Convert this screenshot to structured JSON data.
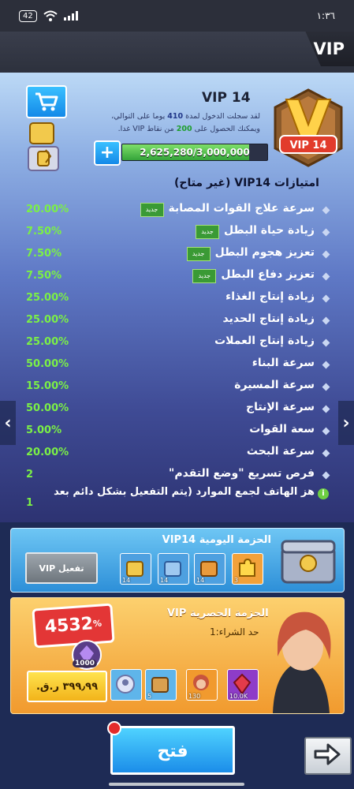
{
  "status_bar": {
    "time": "١:٣٦",
    "battery": "42"
  },
  "header": {
    "title": "VIP"
  },
  "vip": {
    "level_title": "VIP 14",
    "badge_label": "VIP 14",
    "login_line1_a": "لقد سجلت الدخول لمدة",
    "login_days": "410",
    "login_line1_b": "يوما على التوالي،",
    "login_line2_a": "ويمكنك الحصول على",
    "login_points": "200",
    "login_line2_b": "من نقاط VIP غدا.",
    "progress_text": "2,625,280/3,000,000",
    "progress_fraction": 0.875
  },
  "privileges": {
    "heading": "امتيازات  VIP14   (غير متاح)",
    "new_label": "جديد",
    "items": [
      {
        "name": "سرعة علاج القوات المصابة",
        "value": "20.00%",
        "new": true
      },
      {
        "name": "زيادة حياة البطل",
        "value": "7.50%",
        "new": true
      },
      {
        "name": "تعزيز هجوم البطل",
        "value": "7.50%",
        "new": true
      },
      {
        "name": "تعزيز دفاع البطل",
        "value": "7.50%",
        "new": true
      },
      {
        "name": "زيادة إنتاج الغذاء",
        "value": "25.00%",
        "new": false
      },
      {
        "name": "زيادة إنتاج الحديد",
        "value": "25.00%",
        "new": false
      },
      {
        "name": "زيادة إنتاج العملات",
        "value": "25.00%",
        "new": false
      },
      {
        "name": "سرعة البناء",
        "value": "50.00%",
        "new": false
      },
      {
        "name": "سرعة المسيرة",
        "value": "15.00%",
        "new": false
      },
      {
        "name": "سرعة الإنتاج",
        "value": "50.00%",
        "new": false
      },
      {
        "name": "سعة القوات",
        "value": "5.00%",
        "new": false
      },
      {
        "name": "سرعة البحث",
        "value": "20.00%",
        "new": false
      },
      {
        "name": "فرص تسريع \"وضع التقدم\"",
        "value": "2",
        "new": false
      }
    ],
    "shake_text": "هز الهاتف لجمع الموارد (يتم التفعيل بشكل دائم بعد",
    "shake_value": "1"
  },
  "daily_pack": {
    "title": "الحزمة اليومية VIP14",
    "activate_label": "تفعيل VIP",
    "items": [
      {
        "icon": "gold-chest-icon",
        "count": "14"
      },
      {
        "icon": "blue-chest-icon",
        "count": "14"
      },
      {
        "icon": "orange-chest-icon",
        "count": "14"
      },
      {
        "icon": "puzzle-piece-icon",
        "count": "3"
      }
    ]
  },
  "exclusive_pack": {
    "title": "الحزمة الحصرية VIP",
    "limit": "حد الشراء:1",
    "discount": "4532",
    "discount_unit": "%",
    "gems": "1000",
    "price": "٣٩٩٫٩٩ ر.ق.",
    "items": [
      {
        "icon": "badge-icon",
        "count": ""
      },
      {
        "icon": "chest-icon",
        "count": "5"
      },
      {
        "icon": "hero-portrait-icon",
        "count": "130"
      },
      {
        "icon": "red-gem-icon",
        "count": "10.0K"
      }
    ]
  },
  "footer": {
    "open_label": "فتح"
  },
  "colors": {
    "accent_blue": "#1b8de9",
    "value_green": "#7bf046",
    "gold": "#f19a2e"
  }
}
